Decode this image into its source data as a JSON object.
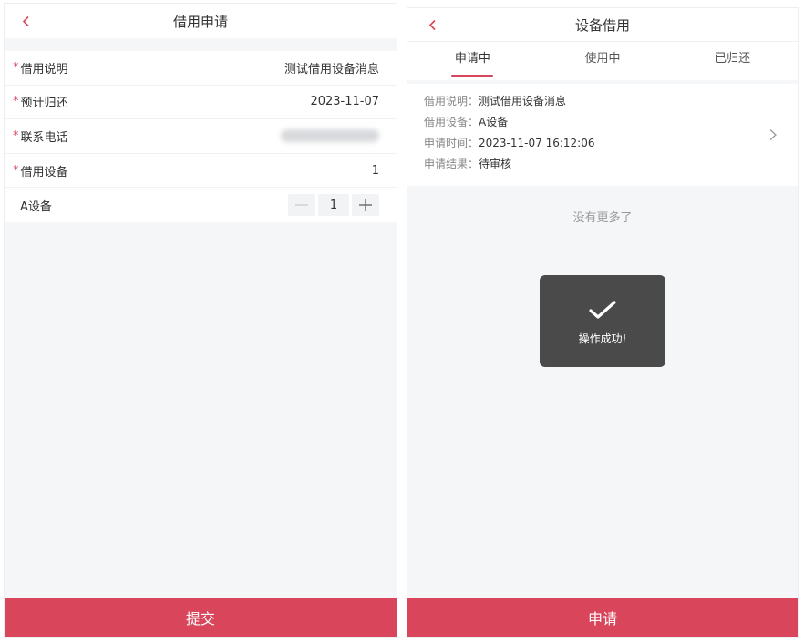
{
  "colors": {
    "accent": "#d9455a",
    "page_bg": "#f5f6f8",
    "text": "#333333",
    "muted": "#999999",
    "toast_bg": "#4a4a4a"
  },
  "left": {
    "header": {
      "back_icon": "back-chevron-icon",
      "title": "借用申请"
    },
    "form": {
      "rows": [
        {
          "required": "*",
          "label": "借用说明",
          "value": "测试借用设备消息"
        },
        {
          "required": "*",
          "label": "预计归还",
          "value": "2023-11-07"
        },
        {
          "required": "*",
          "label": "联系电话"
        },
        {
          "required": "*",
          "label": "借用设备",
          "value": "1"
        }
      ],
      "device": {
        "name": "A设备",
        "minus_icon": "minus-icon",
        "quantity": "1",
        "plus_icon": "plus-icon"
      }
    },
    "submit_label": "提交"
  },
  "right": {
    "header": {
      "back_icon": "back-chevron-icon",
      "title": "设备借用"
    },
    "tabs": [
      {
        "label": "申请中",
        "active": true
      },
      {
        "label": "使用中",
        "active": false
      },
      {
        "label": "已归还",
        "active": false
      }
    ],
    "record": {
      "fields": [
        {
          "key": "借用说明：",
          "value": "测试借用设备消息"
        },
        {
          "key": "借用设备：",
          "value": "A设备"
        },
        {
          "key": "申请时间：",
          "value": "2023-11-07 16:12:06"
        },
        {
          "key": "申请结果：",
          "value": "待审核"
        }
      ],
      "chevron_icon": "chevron-right-icon"
    },
    "list_end_text": "没有更多了",
    "toast": {
      "icon": "check-icon",
      "message": "操作成功!"
    },
    "apply_label": "申请"
  }
}
